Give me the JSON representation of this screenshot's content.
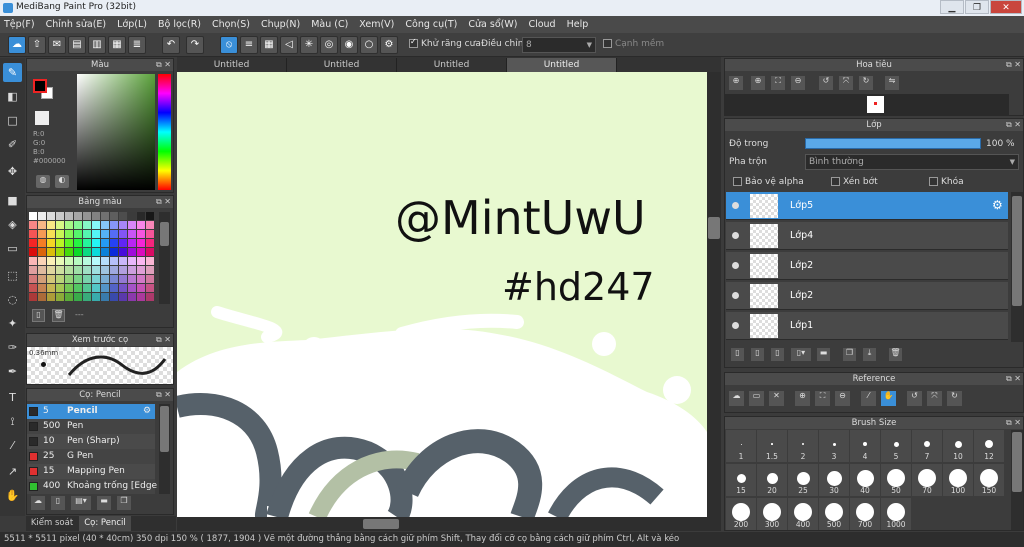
{
  "window": {
    "title": "MediBang Paint Pro (32bit)",
    "minimize": "▁",
    "restore": "❐",
    "close": "✕"
  },
  "menu": [
    "Tệp(F)",
    "Chỉnh sửa(E)",
    "Lớp(L)",
    "Bộ lọc(R)",
    "Chọn(S)",
    "Chụp(N)",
    "Màu (C)",
    "Xem(V)",
    "Công cụ(T)",
    "Cửa sổ(W)",
    "Cloud",
    "Help"
  ],
  "toolbar": {
    "antialias_label": "Khử răng cưa",
    "correction_label": "Điều chỉnh",
    "correction_value": "8",
    "edge_label": "Cạnh mềm"
  },
  "color_panel": {
    "title": "Màu",
    "r": "R:0",
    "g": "G:0",
    "b": "B:0",
    "hex": "#000000"
  },
  "palette_panel": {
    "title": "Bảng màu",
    "more": "---"
  },
  "preview_panel": {
    "title": "Xem trước cọ",
    "size": "0.36mm"
  },
  "brush_panel": {
    "title": "Cọ: Pencil",
    "items": [
      {
        "size": "5",
        "name": "Pencil",
        "color": "#2a2a2a"
      },
      {
        "size": "500",
        "name": "Pen",
        "color": "#2a2a2a"
      },
      {
        "size": "10",
        "name": "Pen (Sharp)",
        "color": "#2a2a2a"
      },
      {
        "size": "25",
        "name": "G Pen",
        "color": "#e03030"
      },
      {
        "size": "15",
        "name": "Mapping Pen",
        "color": "#e03030"
      },
      {
        "size": "400",
        "name": "Khoảng trống [Edge",
        "color": "#30c030"
      }
    ]
  },
  "bottom_tabs": [
    "Kiểm soát cọ",
    "Cọ: Pencil"
  ],
  "canvas": {
    "tabs": [
      "Untitled",
      "Untitled",
      "Untitled",
      "Untitled"
    ],
    "active_tab": 3,
    "text_line1": "@MintUwU",
    "text_line2": "#hd247",
    "bg_color": "#e8f9d0"
  },
  "navigator": {
    "title": "Hoa tiêu"
  },
  "layer_panel": {
    "title": "Lớp",
    "opacity_label": "Độ trong",
    "opacity_value": "100 %",
    "blend_label": "Pha trộn",
    "blend_value": "Bình thường",
    "protect_alpha": "Bảo vệ alpha",
    "clipping": "Xén bớt",
    "lock": "Khóa",
    "layers": [
      "Lớp5",
      "Lớp4",
      "Lớp2",
      "Lớp2",
      "Lớp1"
    ],
    "selected": 0
  },
  "reference_panel": {
    "title": "Reference"
  },
  "brush_size_panel": {
    "title": "Brush Size",
    "sizes": [
      "1",
      "1.5",
      "2",
      "3",
      "4",
      "5",
      "7",
      "10",
      "12",
      "15",
      "20",
      "25",
      "30",
      "40",
      "50",
      "70",
      "100",
      "150",
      "200",
      "300",
      "400",
      "500",
      "700",
      "1000"
    ]
  },
  "status": "5511 * 5511 pixel  (40 * 40cm)  350 dpi  150 %  ( 1877, 1904 )  Vẽ một đường thẳng bằng cách giữ phím Shift, Thay đổi cỡ cọ bằng cách giữ phím Ctrl, Alt và kéo"
}
